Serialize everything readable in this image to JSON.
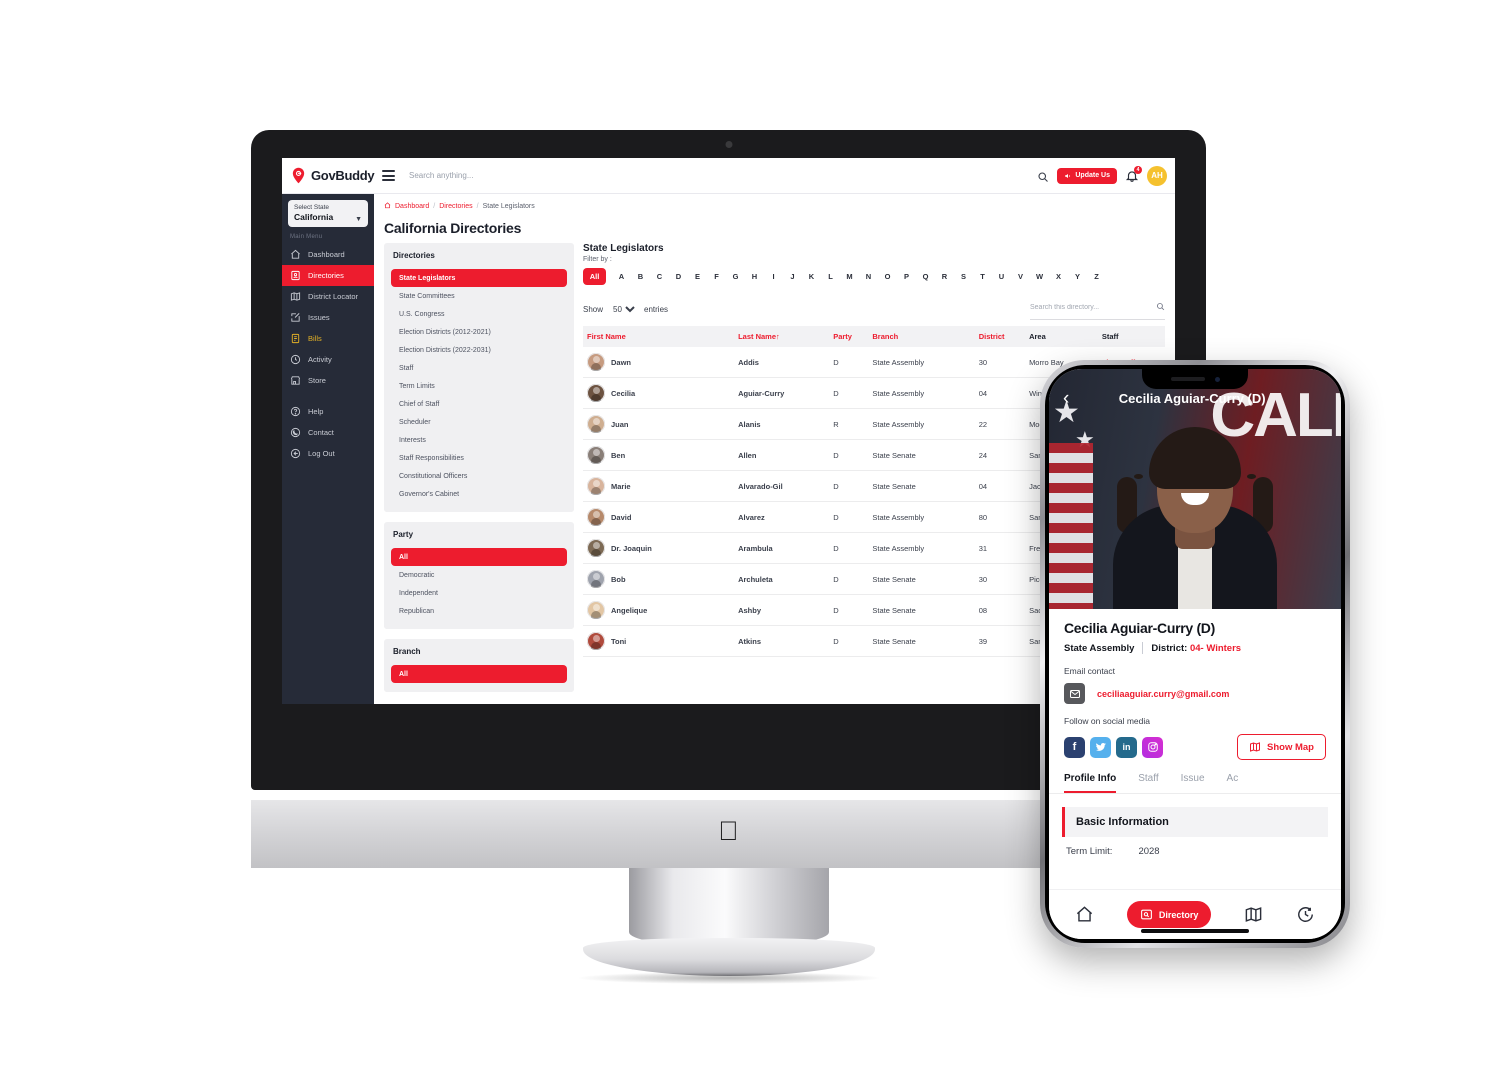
{
  "brand": {
    "name": "GovBuddy",
    "icon": "location-pin-icon"
  },
  "topbar": {
    "search_placeholder": "Search anything...",
    "update_button": "Update Us",
    "notification_count": "4",
    "avatar_initials": "AH"
  },
  "sidebar": {
    "state_label": "Select State",
    "state_value": "California",
    "menu_heading": "Main Menu",
    "items": [
      {
        "label": "Dashboard",
        "icon": "home-icon",
        "active": false
      },
      {
        "label": "Directories",
        "icon": "directory-icon",
        "active": true
      },
      {
        "label": "District Locator",
        "icon": "map-icon",
        "active": false
      },
      {
        "label": "Issues",
        "icon": "edit-square-icon",
        "active": false
      },
      {
        "label": "Bills",
        "icon": "bill-icon",
        "active": false
      },
      {
        "label": "Activity",
        "icon": "clock-icon",
        "active": false
      },
      {
        "label": "Store",
        "icon": "store-icon",
        "active": false
      }
    ],
    "secondary": [
      {
        "label": "Help",
        "icon": "question-circle-icon"
      },
      {
        "label": "Contact",
        "icon": "phone-circle-icon"
      },
      {
        "label": "Log Out",
        "icon": "logout-icon"
      }
    ]
  },
  "breadcrumb": {
    "home_icon": "home-icon",
    "items": [
      "Dashboard",
      "Directories",
      "State Legislators"
    ]
  },
  "page_title": "California Directories",
  "directories_panel": {
    "heading": "Directories",
    "items": [
      "State Legislators",
      "State Committees",
      "U.S. Congress",
      "Election Districts (2012-2021)",
      "Election Districts (2022-2031)",
      "Staff",
      "Term Limits",
      "Chief of Staff",
      "Scheduler",
      "Interests",
      "Staff Responsibilities",
      "Constitutional Officers",
      "Governor's Cabinet"
    ],
    "active": "State Legislators"
  },
  "party_panel": {
    "heading": "Party",
    "items": [
      "All",
      "Democratic",
      "Independent",
      "Republican"
    ],
    "active": "All"
  },
  "branch_panel": {
    "heading": "Branch",
    "items": [
      "All"
    ],
    "active": "All"
  },
  "legislators": {
    "title": "State Legislators",
    "filter_by_label": "Filter by :",
    "alpha": [
      "All",
      "A",
      "B",
      "C",
      "D",
      "E",
      "F",
      "G",
      "H",
      "I",
      "J",
      "K",
      "L",
      "M",
      "N",
      "O",
      "P",
      "Q",
      "R",
      "S",
      "T",
      "U",
      "V",
      "W",
      "X",
      "Y",
      "Z"
    ],
    "alpha_active": "All",
    "show_label": "Show",
    "entries_label": "entries",
    "page_size": "50",
    "search_placeholder": "Search this directory...",
    "columns": [
      "First Name",
      "Last Name",
      "Party",
      "Branch",
      "District",
      "Area",
      "Staff"
    ],
    "sort_column": "Last Name",
    "sort_dir": "asc",
    "staff_link_label": "View Staff",
    "rows": [
      {
        "first": "Dawn",
        "last": "Addis",
        "party": "D",
        "branch": "State Assembly",
        "district": "30",
        "area": "Morro Bay"
      },
      {
        "first": "Cecilia",
        "last": "Aguiar-Curry",
        "party": "D",
        "branch": "State Assembly",
        "district": "04",
        "area": "Winters"
      },
      {
        "first": "Juan",
        "last": "Alanis",
        "party": "R",
        "branch": "State Assembly",
        "district": "22",
        "area": "Modesto"
      },
      {
        "first": "Ben",
        "last": "Allen",
        "party": "D",
        "branch": "State Senate",
        "district": "24",
        "area": "Santa Monica"
      },
      {
        "first": "Marie",
        "last": "Alvarado-Gil",
        "party": "D",
        "branch": "State Senate",
        "district": "04",
        "area": "Jackson"
      },
      {
        "first": "David",
        "last": "Alvarez",
        "party": "D",
        "branch": "State Assembly",
        "district": "80",
        "area": "San Diego"
      },
      {
        "first": "Dr. Joaquin",
        "last": "Arambula",
        "party": "D",
        "branch": "State Assembly",
        "district": "31",
        "area": "Fresno"
      },
      {
        "first": "Bob",
        "last": "Archuleta",
        "party": "D",
        "branch": "State Senate",
        "district": "30",
        "area": "Pico Rivera"
      },
      {
        "first": "Angelique",
        "last": "Ashby",
        "party": "D",
        "branch": "State Senate",
        "district": "08",
        "area": "Sacramento"
      },
      {
        "first": "Toni",
        "last": "Atkins",
        "party": "D",
        "branch": "State Senate",
        "district": "39",
        "area": "San Diego"
      }
    ]
  },
  "phone": {
    "header_title": "Cecilia Aguiar-Curry (D)",
    "back_icon": "chevron-left-icon",
    "profile_name": "Cecilia Aguiar-Curry (D)",
    "branch": "State Assembly",
    "district_label": "District:",
    "district_value": "04- Winters",
    "email_label": "Email contact",
    "email": "ceciliaaguiar.curry@gmail.com",
    "social_label": "Follow on social media",
    "socials": [
      "facebook-icon",
      "twitter-icon",
      "linkedin-icon",
      "instagram-icon"
    ],
    "map_button": "Show Map",
    "tabs": [
      "Profile Info",
      "Staff",
      "Issue",
      "Ac"
    ],
    "active_tab": "Profile Info",
    "section_title": "Basic Information",
    "term_limit_label": "Term Limit:",
    "term_limit_value": "2028",
    "bottom_nav": [
      {
        "label": "",
        "icon": "home-icon",
        "active": false
      },
      {
        "label": "Directory",
        "icon": "directory-icon",
        "active": true
      },
      {
        "label": "",
        "icon": "map-icon",
        "active": false
      },
      {
        "label": "",
        "icon": "history-icon",
        "active": false
      }
    ]
  },
  "colors": {
    "accent": "#ed1c2e",
    "sidebar": "#262b38",
    "panel": "#f0f0f2",
    "avatar": "#f5c12e"
  }
}
